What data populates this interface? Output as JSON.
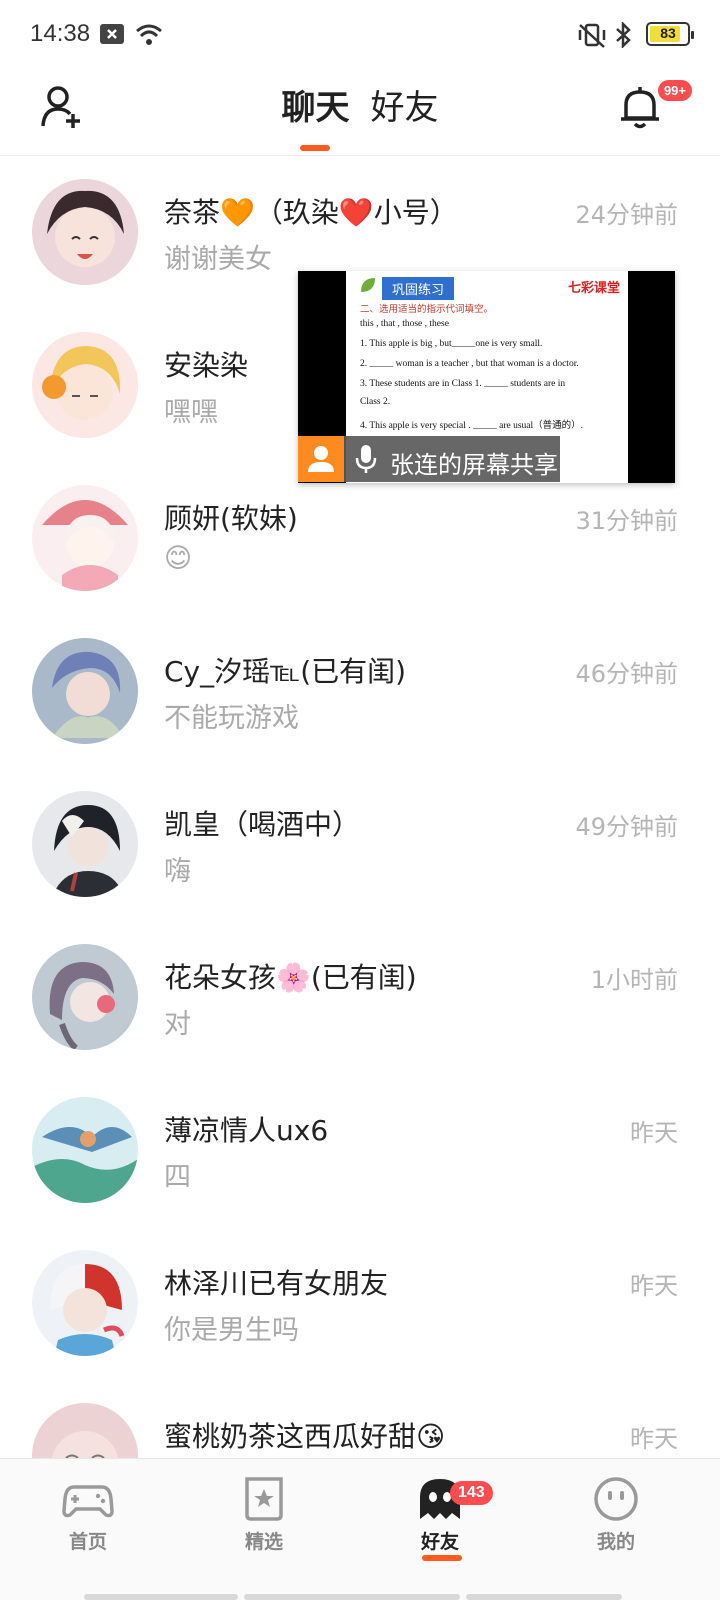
{
  "status_bar": {
    "time": "14:38",
    "battery": "83",
    "battery_level": 0.83,
    "icons": [
      "close-box-icon",
      "wifi-icon",
      "vibrate-off-icon",
      "bluetooth-icon",
      "battery-icon"
    ]
  },
  "header": {
    "tabs": [
      {
        "label": "聊天",
        "active": true
      },
      {
        "label": "好友",
        "active": false
      }
    ],
    "notification_badge": "99+",
    "accent_color": "#ff5a1f"
  },
  "chats": [
    {
      "name": "奈茶🧡（玖染❤️小号）",
      "message": "谢谢美女",
      "time": "24分钟前",
      "avatar_color": "#d8b8c0"
    },
    {
      "name": "安染染",
      "message": "嘿嘿",
      "time": "",
      "avatar_color": "#f5c9b6"
    },
    {
      "name": "顾妍(软妹)",
      "message": "😊",
      "time": "31分钟前",
      "avatar_color": "#f1c6cf"
    },
    {
      "name": "Cy_汐瑶℡(已有闺)",
      "message": "不能玩游戏",
      "time": "46分钟前",
      "avatar_color": "#a9b7cc"
    },
    {
      "name": "凯皇（喝酒中）",
      "message": "嗨",
      "time": "49分钟前",
      "avatar_color": "#3b3f4a"
    },
    {
      "name": "花朵女孩🌸(已有闺)",
      "message": "对",
      "time": "1小时前",
      "avatar_color": "#b9c4cf"
    },
    {
      "name": "薄凉情人ux6",
      "message": "四",
      "time": "昨天",
      "avatar_color": "#7fb7cf"
    },
    {
      "name": "林泽川已有女朋友",
      "message": "你是男生吗",
      "time": "昨天",
      "avatar_color": "#cfd9e6"
    },
    {
      "name": "蜜桃奶茶这西瓜好甜😘",
      "message": "",
      "time": "昨天",
      "avatar_color": "#e8c8c8"
    }
  ],
  "screen_share": {
    "label": "张连的屏幕共享",
    "slide_tag": "巩固练习",
    "slide_brand": "七彩课堂",
    "slide_lines": [
      "二、选用适当的指示代词填空。",
      "this , that , those , these",
      "1. This apple is big , but_____one is very small.",
      "2. _____ woman is a teacher , but that woman is a doctor.",
      "3. These students are in Class 1. _____ students are in",
      "Class 2.",
      "4. This apple is very special . _____ are usual（普通的）."
    ]
  },
  "bottom_nav": {
    "items": [
      {
        "label": "首页",
        "icon": "gamepad-icon",
        "active": false
      },
      {
        "label": "精选",
        "icon": "star-bookmark-icon",
        "active": false
      },
      {
        "label": "好友",
        "icon": "ghost-icon",
        "active": true,
        "badge": "143"
      },
      {
        "label": "我的",
        "icon": "face-icon",
        "active": false
      }
    ]
  }
}
